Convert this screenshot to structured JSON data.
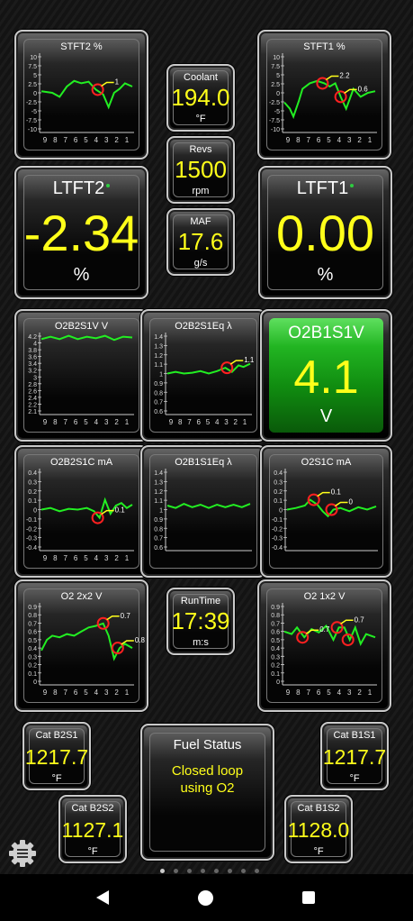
{
  "stft2": {
    "title": "STFT2  %",
    "yticks": [
      "10",
      "7.5",
      "5",
      "2.5",
      "0",
      "-2.5",
      "-5",
      "-7.5",
      "-10"
    ],
    "xticks": [
      "9",
      "8",
      "7",
      "6",
      "5",
      "4",
      "3",
      "2",
      "1"
    ],
    "markers": [
      "1"
    ]
  },
  "stft1": {
    "title": "STFT1  %",
    "yticks": [
      "10",
      "7.5",
      "5",
      "2.5",
      "0",
      "-2.5",
      "-5",
      "-7.5",
      "-10"
    ],
    "xticks": [
      "9",
      "8",
      "7",
      "6",
      "5",
      "4",
      "3",
      "2",
      "1"
    ],
    "markers": [
      "2.2",
      "0.6"
    ]
  },
  "coolant": {
    "title": "Coolant",
    "value": "194.0",
    "unit": "°F"
  },
  "revs": {
    "title": "Revs",
    "value": "1500",
    "unit": "rpm"
  },
  "maf": {
    "title": "MAF",
    "value": "17.6",
    "unit": "g/s"
  },
  "ltft2": {
    "title": "LTFT2",
    "value": "-2.34",
    "unit": "%"
  },
  "ltft1": {
    "title": "LTFT1",
    "value": "0.00",
    "unit": "%"
  },
  "o2b2s1v": {
    "title": "O2B2S1V  V",
    "yticks": [
      "4.2",
      "4",
      "3.8",
      "3.6",
      "3.4",
      "3.2",
      "3",
      "2.8",
      "2.6",
      "2.4",
      "2.2",
      "2.1"
    ],
    "xticks": [
      "9",
      "8",
      "7",
      "6",
      "5",
      "4",
      "3",
      "2",
      "1"
    ]
  },
  "o2b2s1eq": {
    "title": "O2B2S1Eq  λ",
    "yticks": [
      "1.4",
      "1.3",
      "1.2",
      "1.1",
      "1",
      "0.9",
      "0.8",
      "0.7",
      "0.6"
    ],
    "xticks": [
      "9",
      "8",
      "7",
      "6",
      "5",
      "4",
      "3",
      "2",
      "1"
    ],
    "markers": [
      "1.1"
    ]
  },
  "o2b1s1v": {
    "title": "O2B1S1V",
    "value": "4.1",
    "unit": "V"
  },
  "o2b2s1c": {
    "title": "O2B2S1C  mA",
    "yticks": [
      "0.4",
      "0.3",
      "0.2",
      "0.1",
      "0",
      "-0.1",
      "-0.2",
      "-0.3",
      "-0.4"
    ],
    "xticks": [
      "9",
      "8",
      "7",
      "6",
      "5",
      "4",
      "3",
      "2",
      "1"
    ],
    "markers": [
      "0.1"
    ]
  },
  "o2b1s1eq": {
    "title": "O2B1S1Eq  λ",
    "yticks": [
      "1.4",
      "1.3",
      "1.2",
      "1.1",
      "1",
      "0.9",
      "0.8",
      "0.7",
      "0.6"
    ],
    "xticks": []
  },
  "o2s1c": {
    "title": "O2S1C  mA",
    "yticks": [
      "0.4",
      "0.3",
      "0.2",
      "0.1",
      "0",
      "-0.1",
      "-0.2",
      "-0.3",
      "-0.4"
    ],
    "xticks": [],
    "markers": [
      "0.1",
      "0"
    ]
  },
  "o22x2": {
    "title": "O2 2x2  V",
    "yticks": [
      "0.9",
      "0.8",
      "0.7",
      "0.6",
      "0.5",
      "0.4",
      "0.3",
      "0.2",
      "0.1",
      "0"
    ],
    "xticks": [
      "9",
      "8",
      "7",
      "6",
      "5",
      "4",
      "3",
      "2",
      "1"
    ],
    "markers": [
      "0.7",
      "0.8"
    ]
  },
  "runtime": {
    "title": "RunTime",
    "value": "17:39",
    "unit": "m:s"
  },
  "o21x2": {
    "title": "O2 1x2  V",
    "yticks": [
      "0.9",
      "0.8",
      "0.7",
      "0.6",
      "0.5",
      "0.4",
      "0.3",
      "0.2",
      "0.1",
      "0"
    ],
    "xticks": [
      "9",
      "8",
      "7",
      "6",
      "5",
      "4",
      "3",
      "2",
      "1"
    ],
    "markers": [
      "0.7",
      "0.7"
    ]
  },
  "catb2s1": {
    "title": "Cat B2S1",
    "value": "1217.7",
    "unit": "°F"
  },
  "catb1s1": {
    "title": "Cat B1S1",
    "value": "1217.7",
    "unit": "°F"
  },
  "catb2s2": {
    "title": "Cat B2S2",
    "value": "1127.1",
    "unit": "°F"
  },
  "catb1s2": {
    "title": "Cat B1S2",
    "value": "1128.0",
    "unit": "°F"
  },
  "fuel": {
    "title": "Fuel Status",
    "line1": "Closed loop",
    "line2": "using O2"
  },
  "pager": {
    "pages": 8,
    "active": 0
  },
  "icons": {
    "settings": "gear-icon",
    "back": "nav-back-icon",
    "home": "nav-home-icon",
    "recents": "nav-recents-icon"
  },
  "colors": {
    "value": "#ffff1a",
    "line": "#22ee22",
    "marker": "#ff2020",
    "green_panel": "#22b522"
  }
}
